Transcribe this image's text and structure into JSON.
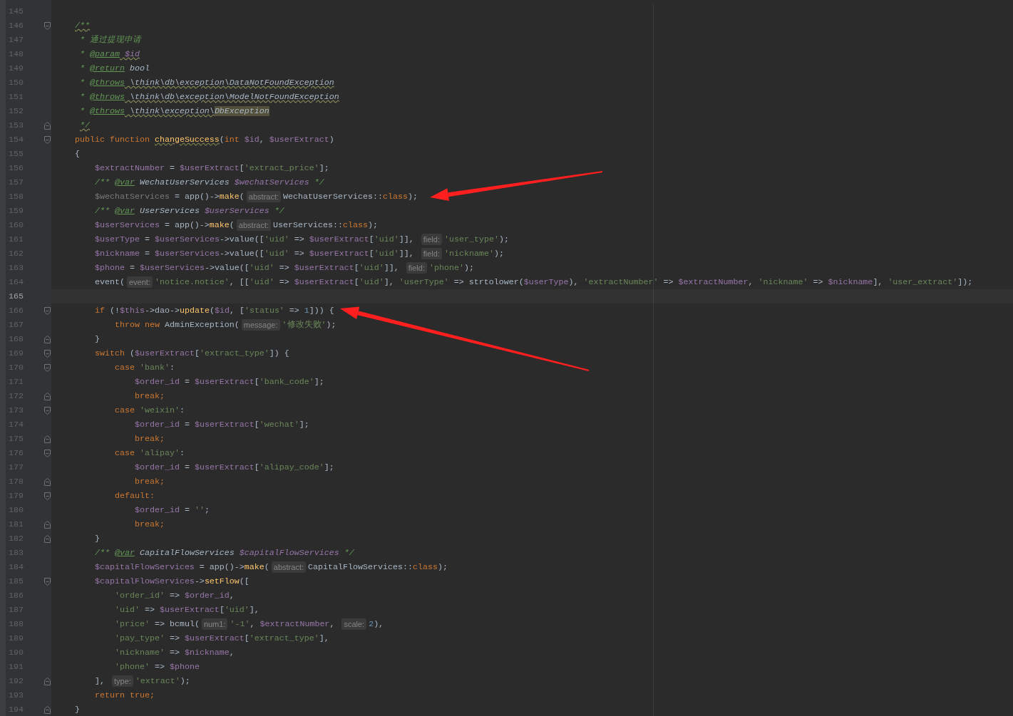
{
  "editor": {
    "lines": [
      {
        "number": "145",
        "current": false,
        "kind": "plain"
      },
      {
        "number": "146",
        "current": false,
        "kind": "fold-start",
        "tokens": [
          {
            "kind": "doc-warn",
            "text": "    /**"
          }
        ]
      },
      {
        "number": "147",
        "current": false,
        "kind": "plain",
        "tokens": [
          {
            "kind": "doc",
            "text": "     * 通过提现申请"
          }
        ]
      },
      {
        "number": "148",
        "current": false,
        "kind": "plain",
        "tokens": [
          {
            "kind": "doc",
            "text": "     * "
          },
          {
            "kind": "doctag",
            "text": "@param"
          },
          {
            "kind": "doc-var-warn",
            "text": " $id"
          }
        ]
      },
      {
        "number": "149",
        "current": false,
        "kind": "plain",
        "tokens": [
          {
            "kind": "doc",
            "text": "     * "
          },
          {
            "kind": "doctag",
            "text": "@return"
          },
          {
            "kind": "doc-type",
            "text": " bool"
          }
        ]
      },
      {
        "number": "150",
        "current": false,
        "kind": "plain",
        "tokens": [
          {
            "kind": "doc",
            "text": "     * "
          },
          {
            "kind": "doctag",
            "text": "@throws"
          },
          {
            "kind": "doc-type-warn",
            "text": " \\think\\db\\exception\\DataNotFoundException"
          }
        ]
      },
      {
        "number": "151",
        "current": false,
        "kind": "plain",
        "tokens": [
          {
            "kind": "doc",
            "text": "     * "
          },
          {
            "kind": "doctag",
            "text": "@throws"
          },
          {
            "kind": "doc-type-warn",
            "text": " \\think\\db\\exception\\ModelNotFoundException"
          }
        ]
      },
      {
        "number": "152",
        "current": false,
        "kind": "plain",
        "tokens": [
          {
            "kind": "doc",
            "text": "     * "
          },
          {
            "kind": "doctag",
            "text": "@throws"
          },
          {
            "kind": "doc-type-warn",
            "text": " \\think\\exception\\"
          },
          {
            "kind": "doc-match",
            "text": "DbException"
          }
        ]
      },
      {
        "number": "153",
        "current": false,
        "kind": "fold-end",
        "tokens": [
          {
            "kind": "doc-warn",
            "text": "     */"
          }
        ]
      },
      {
        "number": "154",
        "current": false,
        "kind": "fold-start",
        "tokens": [
          {
            "kind": "keyword",
            "text": "    public function "
          },
          {
            "kind": "fn-def",
            "text": "changeSuccess"
          },
          {
            "kind": "plain",
            "text": "("
          },
          {
            "kind": "keyword",
            "text": "int "
          },
          {
            "kind": "variable",
            "text": "$id"
          },
          {
            "kind": "plain",
            "text": ", "
          },
          {
            "kind": "variable",
            "text": "$userExtract"
          },
          {
            "kind": "plain",
            "text": ")"
          }
        ]
      },
      {
        "number": "155",
        "current": false,
        "kind": "plain",
        "tokens": [
          {
            "kind": "plain",
            "text": "    {"
          }
        ]
      },
      {
        "number": "156",
        "current": false,
        "kind": "plain",
        "tokens": [
          {
            "kind": "variable",
            "text": "        $extractNumber"
          },
          {
            "kind": "plain",
            "text": " = "
          },
          {
            "kind": "variable",
            "text": "$userExtract"
          },
          {
            "kind": "plain",
            "text": "["
          },
          {
            "kind": "string",
            "text": "'extract_price'"
          },
          {
            "kind": "plain",
            "text": "];"
          }
        ]
      },
      {
        "number": "157",
        "current": false,
        "kind": "plain",
        "tokens": [
          {
            "kind": "doc",
            "text": "        /** "
          },
          {
            "kind": "doctag",
            "text": "@var"
          },
          {
            "kind": "doc-type",
            "text": " WechatUserServices "
          },
          {
            "kind": "doc-var",
            "text": "$wechatServices"
          },
          {
            "kind": "doc",
            "text": " */"
          }
        ]
      },
      {
        "number": "158",
        "current": false,
        "kind": "plain",
        "tokens": [
          {
            "kind": "unused",
            "text": "        $wechatServices"
          },
          {
            "kind": "plain",
            "text": " = app()->"
          },
          {
            "kind": "function",
            "text": "make"
          },
          {
            "kind": "plain",
            "text": "("
          },
          {
            "kind": "hint",
            "text": "abstract:"
          },
          {
            "kind": "plain",
            "text": "WechatUserServices::"
          },
          {
            "kind": "keyword",
            "text": "class"
          },
          {
            "kind": "plain",
            "text": ");"
          }
        ]
      },
      {
        "number": "159",
        "current": false,
        "kind": "plain",
        "tokens": [
          {
            "kind": "doc",
            "text": "        /** "
          },
          {
            "kind": "doctag",
            "text": "@var"
          },
          {
            "kind": "doc-type",
            "text": " UserServices "
          },
          {
            "kind": "doc-var",
            "text": "$userServices"
          },
          {
            "kind": "doc",
            "text": " */"
          }
        ]
      },
      {
        "number": "160",
        "current": false,
        "kind": "plain",
        "tokens": [
          {
            "kind": "variable",
            "text": "        $userServices"
          },
          {
            "kind": "plain",
            "text": " = app()->"
          },
          {
            "kind": "function",
            "text": "make"
          },
          {
            "kind": "plain",
            "text": "("
          },
          {
            "kind": "hint",
            "text": "abstract:"
          },
          {
            "kind": "plain",
            "text": "UserServices::"
          },
          {
            "kind": "keyword",
            "text": "class"
          },
          {
            "kind": "plain",
            "text": ");"
          }
        ]
      },
      {
        "number": "161",
        "current": false,
        "kind": "plain",
        "tokens": [
          {
            "kind": "variable",
            "text": "        $userType"
          },
          {
            "kind": "plain",
            "text": " = "
          },
          {
            "kind": "variable",
            "text": "$userServices"
          },
          {
            "kind": "plain",
            "text": "->value(["
          },
          {
            "kind": "string",
            "text": "'uid'"
          },
          {
            "kind": "plain",
            "text": " => "
          },
          {
            "kind": "variable",
            "text": "$userExtract"
          },
          {
            "kind": "plain",
            "text": "["
          },
          {
            "kind": "string",
            "text": "'uid'"
          },
          {
            "kind": "plain",
            "text": "]], "
          },
          {
            "kind": "hint",
            "text": "field:"
          },
          {
            "kind": "string",
            "text": "'user_type'"
          },
          {
            "kind": "plain",
            "text": ");"
          }
        ]
      },
      {
        "number": "162",
        "current": false,
        "kind": "plain",
        "tokens": [
          {
            "kind": "variable",
            "text": "        $nickname"
          },
          {
            "kind": "plain",
            "text": " = "
          },
          {
            "kind": "variable",
            "text": "$userServices"
          },
          {
            "kind": "plain",
            "text": "->value(["
          },
          {
            "kind": "string",
            "text": "'uid'"
          },
          {
            "kind": "plain",
            "text": " => "
          },
          {
            "kind": "variable",
            "text": "$userExtract"
          },
          {
            "kind": "plain",
            "text": "["
          },
          {
            "kind": "string",
            "text": "'uid'"
          },
          {
            "kind": "plain",
            "text": "]], "
          },
          {
            "kind": "hint",
            "text": "field:"
          },
          {
            "kind": "string",
            "text": "'nickname'"
          },
          {
            "kind": "plain",
            "text": ");"
          }
        ]
      },
      {
        "number": "163",
        "current": false,
        "kind": "plain",
        "tokens": [
          {
            "kind": "variable",
            "text": "        $phone"
          },
          {
            "kind": "plain",
            "text": " = "
          },
          {
            "kind": "variable",
            "text": "$userServices"
          },
          {
            "kind": "plain",
            "text": "->value(["
          },
          {
            "kind": "string",
            "text": "'uid'"
          },
          {
            "kind": "plain",
            "text": " => "
          },
          {
            "kind": "variable",
            "text": "$userExtract"
          },
          {
            "kind": "plain",
            "text": "["
          },
          {
            "kind": "string",
            "text": "'uid'"
          },
          {
            "kind": "plain",
            "text": "]], "
          },
          {
            "kind": "hint",
            "text": "field:"
          },
          {
            "kind": "string",
            "text": "'phone'"
          },
          {
            "kind": "plain",
            "text": ");"
          }
        ]
      },
      {
        "number": "164",
        "current": false,
        "kind": "plain",
        "tokens": [
          {
            "kind": "plain",
            "text": "        event("
          },
          {
            "kind": "hint",
            "text": "event:"
          },
          {
            "kind": "string",
            "text": "'notice.notice'"
          },
          {
            "kind": "plain",
            "text": ", [["
          },
          {
            "kind": "string",
            "text": "'uid'"
          },
          {
            "kind": "plain",
            "text": " => "
          },
          {
            "kind": "variable",
            "text": "$userExtract"
          },
          {
            "kind": "plain",
            "text": "["
          },
          {
            "kind": "string",
            "text": "'uid'"
          },
          {
            "kind": "plain",
            "text": "], "
          },
          {
            "kind": "string",
            "text": "'userType'"
          },
          {
            "kind": "plain",
            "text": " => strtolower("
          },
          {
            "kind": "variable",
            "text": "$userType"
          },
          {
            "kind": "plain",
            "text": "), "
          },
          {
            "kind": "string",
            "text": "'extractNumber'"
          },
          {
            "kind": "plain",
            "text": " => "
          },
          {
            "kind": "variable",
            "text": "$extractNumber"
          },
          {
            "kind": "plain",
            "text": ", "
          },
          {
            "kind": "string",
            "text": "'nickname'"
          },
          {
            "kind": "plain",
            "text": " => "
          },
          {
            "kind": "variable",
            "text": "$nickname"
          },
          {
            "kind": "plain",
            "text": "], "
          },
          {
            "kind": "string",
            "text": "'user_extract'"
          },
          {
            "kind": "plain",
            "text": "]);"
          }
        ]
      },
      {
        "number": "165",
        "current": true,
        "kind": "plain"
      },
      {
        "number": "166",
        "current": false,
        "kind": "fold-start",
        "tokens": [
          {
            "kind": "keyword",
            "text": "        if "
          },
          {
            "kind": "plain",
            "text": "(!"
          },
          {
            "kind": "variable",
            "text": "$this"
          },
          {
            "kind": "plain",
            "text": "->dao->"
          },
          {
            "kind": "function",
            "text": "update"
          },
          {
            "kind": "plain",
            "text": "("
          },
          {
            "kind": "variable",
            "text": "$id"
          },
          {
            "kind": "plain",
            "text": ", ["
          },
          {
            "kind": "string",
            "text": "'status'"
          },
          {
            "kind": "plain",
            "text": " => "
          },
          {
            "kind": "number",
            "text": "1"
          },
          {
            "kind": "plain",
            "text": "])) {"
          }
        ]
      },
      {
        "number": "167",
        "current": false,
        "kind": "plain",
        "tokens": [
          {
            "kind": "keyword",
            "text": "            throw new "
          },
          {
            "kind": "plain",
            "text": "AdminException("
          },
          {
            "kind": "hint",
            "text": "message:"
          },
          {
            "kind": "string",
            "text": "'修改失败'"
          },
          {
            "kind": "plain",
            "text": ");"
          }
        ]
      },
      {
        "number": "168",
        "current": false,
        "kind": "fold-end",
        "tokens": [
          {
            "kind": "plain",
            "text": "        }"
          }
        ]
      },
      {
        "number": "169",
        "current": false,
        "kind": "fold-start",
        "tokens": [
          {
            "kind": "keyword",
            "text": "        switch "
          },
          {
            "kind": "plain",
            "text": "("
          },
          {
            "kind": "variable",
            "text": "$userExtract"
          },
          {
            "kind": "plain",
            "text": "["
          },
          {
            "kind": "string",
            "text": "'extract_type'"
          },
          {
            "kind": "plain",
            "text": "]) {"
          }
        ]
      },
      {
        "number": "170",
        "current": false,
        "kind": "fold-start",
        "tokens": [
          {
            "kind": "keyword",
            "text": "            case "
          },
          {
            "kind": "string",
            "text": "'bank'"
          },
          {
            "kind": "plain",
            "text": ":"
          }
        ]
      },
      {
        "number": "171",
        "current": false,
        "kind": "plain",
        "tokens": [
          {
            "kind": "variable",
            "text": "                $order_id"
          },
          {
            "kind": "plain",
            "text": " = "
          },
          {
            "kind": "variable",
            "text": "$userExtract"
          },
          {
            "kind": "plain",
            "text": "["
          },
          {
            "kind": "string",
            "text": "'bank_code'"
          },
          {
            "kind": "plain",
            "text": "];"
          }
        ]
      },
      {
        "number": "172",
        "current": false,
        "kind": "fold-end",
        "tokens": [
          {
            "kind": "keyword",
            "text": "                break;"
          }
        ]
      },
      {
        "number": "173",
        "current": false,
        "kind": "fold-start",
        "tokens": [
          {
            "kind": "keyword",
            "text": "            case "
          },
          {
            "kind": "string",
            "text": "'weixin'"
          },
          {
            "kind": "plain",
            "text": ":"
          }
        ]
      },
      {
        "number": "174",
        "current": false,
        "kind": "plain",
        "tokens": [
          {
            "kind": "variable",
            "text": "                $order_id"
          },
          {
            "kind": "plain",
            "text": " = "
          },
          {
            "kind": "variable",
            "text": "$userExtract"
          },
          {
            "kind": "plain",
            "text": "["
          },
          {
            "kind": "string",
            "text": "'wechat'"
          },
          {
            "kind": "plain",
            "text": "];"
          }
        ]
      },
      {
        "number": "175",
        "current": false,
        "kind": "fold-end",
        "tokens": [
          {
            "kind": "keyword",
            "text": "                break;"
          }
        ]
      },
      {
        "number": "176",
        "current": false,
        "kind": "fold-start",
        "tokens": [
          {
            "kind": "keyword",
            "text": "            case "
          },
          {
            "kind": "string",
            "text": "'alipay'"
          },
          {
            "kind": "plain",
            "text": ":"
          }
        ]
      },
      {
        "number": "177",
        "current": false,
        "kind": "plain",
        "tokens": [
          {
            "kind": "variable",
            "text": "                $order_id"
          },
          {
            "kind": "plain",
            "text": " = "
          },
          {
            "kind": "variable",
            "text": "$userExtract"
          },
          {
            "kind": "plain",
            "text": "["
          },
          {
            "kind": "string",
            "text": "'alipay_code'"
          },
          {
            "kind": "plain",
            "text": "];"
          }
        ]
      },
      {
        "number": "178",
        "current": false,
        "kind": "fold-end",
        "tokens": [
          {
            "kind": "keyword",
            "text": "                break;"
          }
        ]
      },
      {
        "number": "179",
        "current": false,
        "kind": "fold-start",
        "tokens": [
          {
            "kind": "keyword",
            "text": "            default:"
          }
        ]
      },
      {
        "number": "180",
        "current": false,
        "kind": "plain",
        "tokens": [
          {
            "kind": "variable",
            "text": "                $order_id"
          },
          {
            "kind": "plain",
            "text": " = "
          },
          {
            "kind": "string",
            "text": "''"
          },
          {
            "kind": "plain",
            "text": ";"
          }
        ]
      },
      {
        "number": "181",
        "current": false,
        "kind": "fold-end",
        "tokens": [
          {
            "kind": "keyword",
            "text": "                break;"
          }
        ]
      },
      {
        "number": "182",
        "current": false,
        "kind": "fold-end",
        "tokens": [
          {
            "kind": "plain",
            "text": "        }"
          }
        ]
      },
      {
        "number": "183",
        "current": false,
        "kind": "plain",
        "tokens": [
          {
            "kind": "doc",
            "text": "        /** "
          },
          {
            "kind": "doctag",
            "text": "@var"
          },
          {
            "kind": "doc-type",
            "text": " CapitalFlowServices "
          },
          {
            "kind": "doc-var",
            "text": "$capitalFlowServices"
          },
          {
            "kind": "doc",
            "text": " */"
          }
        ]
      },
      {
        "number": "184",
        "current": false,
        "kind": "plain",
        "tokens": [
          {
            "kind": "variable",
            "text": "        $capitalFlowServices"
          },
          {
            "kind": "plain",
            "text": " = app()->"
          },
          {
            "kind": "function",
            "text": "make"
          },
          {
            "kind": "plain",
            "text": "("
          },
          {
            "kind": "hint",
            "text": "abstract:"
          },
          {
            "kind": "plain",
            "text": "CapitalFlowServices::"
          },
          {
            "kind": "keyword",
            "text": "class"
          },
          {
            "kind": "plain",
            "text": ");"
          }
        ]
      },
      {
        "number": "185",
        "current": false,
        "kind": "fold-start",
        "tokens": [
          {
            "kind": "variable",
            "text": "        $capitalFlowServices"
          },
          {
            "kind": "plain",
            "text": "->"
          },
          {
            "kind": "function",
            "text": "setFlow"
          },
          {
            "kind": "plain",
            "text": "(["
          }
        ]
      },
      {
        "number": "186",
        "current": false,
        "kind": "plain",
        "tokens": [
          {
            "kind": "string",
            "text": "            'order_id'"
          },
          {
            "kind": "plain",
            "text": " => "
          },
          {
            "kind": "variable",
            "text": "$order_id"
          },
          {
            "kind": "plain",
            "text": ","
          }
        ]
      },
      {
        "number": "187",
        "current": false,
        "kind": "plain",
        "tokens": [
          {
            "kind": "string",
            "text": "            'uid'"
          },
          {
            "kind": "plain",
            "text": " => "
          },
          {
            "kind": "variable",
            "text": "$userExtract"
          },
          {
            "kind": "plain",
            "text": "["
          },
          {
            "kind": "string",
            "text": "'uid'"
          },
          {
            "kind": "plain",
            "text": "],"
          }
        ]
      },
      {
        "number": "188",
        "current": false,
        "kind": "plain",
        "tokens": [
          {
            "kind": "string",
            "text": "            'price'"
          },
          {
            "kind": "plain",
            "text": " => bcmul("
          },
          {
            "kind": "hint",
            "text": "num1:"
          },
          {
            "kind": "string",
            "text": "'-1'"
          },
          {
            "kind": "plain",
            "text": ", "
          },
          {
            "kind": "variable",
            "text": "$extractNumber"
          },
          {
            "kind": "plain",
            "text": ", "
          },
          {
            "kind": "hint",
            "text": "scale:"
          },
          {
            "kind": "number",
            "text": "2"
          },
          {
            "kind": "plain",
            "text": "),"
          }
        ]
      },
      {
        "number": "189",
        "current": false,
        "kind": "plain",
        "tokens": [
          {
            "kind": "string",
            "text": "            'pay_type'"
          },
          {
            "kind": "plain",
            "text": " => "
          },
          {
            "kind": "variable",
            "text": "$userExtract"
          },
          {
            "kind": "plain",
            "text": "["
          },
          {
            "kind": "string",
            "text": "'extract_type'"
          },
          {
            "kind": "plain",
            "text": "],"
          }
        ]
      },
      {
        "number": "190",
        "current": false,
        "kind": "plain",
        "tokens": [
          {
            "kind": "string",
            "text": "            'nickname'"
          },
          {
            "kind": "plain",
            "text": " => "
          },
          {
            "kind": "variable",
            "text": "$nickname"
          },
          {
            "kind": "plain",
            "text": ","
          }
        ]
      },
      {
        "number": "191",
        "current": false,
        "kind": "plain",
        "tokens": [
          {
            "kind": "string",
            "text": "            'phone'"
          },
          {
            "kind": "plain",
            "text": " => "
          },
          {
            "kind": "variable",
            "text": "$phone"
          }
        ]
      },
      {
        "number": "192",
        "current": false,
        "kind": "fold-end",
        "tokens": [
          {
            "kind": "plain",
            "text": "        ], "
          },
          {
            "kind": "hint",
            "text": "type:"
          },
          {
            "kind": "string",
            "text": "'extract'"
          },
          {
            "kind": "plain",
            "text": ");"
          }
        ]
      },
      {
        "number": "193",
        "current": false,
        "kind": "plain",
        "tokens": [
          {
            "kind": "keyword",
            "text": "        return true;"
          }
        ]
      },
      {
        "number": "194",
        "current": false,
        "kind": "fold-end",
        "tokens": [
          {
            "kind": "plain",
            "text": "    }"
          }
        ]
      }
    ]
  }
}
